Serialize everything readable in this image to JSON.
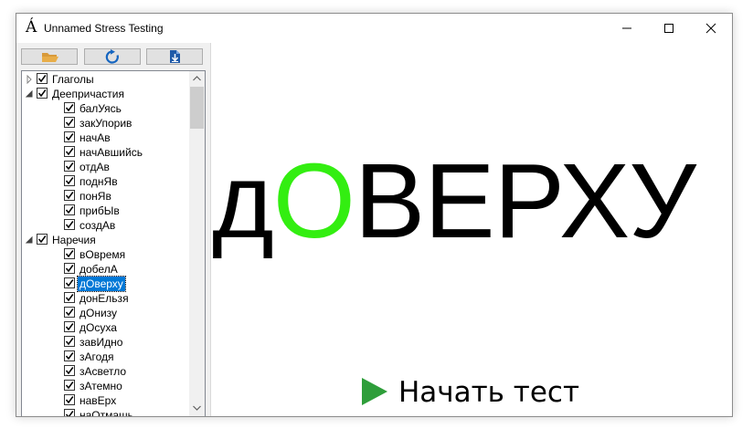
{
  "window": {
    "title": "Unnamed Stress Testing",
    "icon": "Á",
    "icon_name": "accent-a-icon"
  },
  "toolbar": {
    "open_icon": "folder-open-icon",
    "refresh_icon": "refresh-icon",
    "export_icon": "file-download-icon"
  },
  "tree": {
    "nodes": [
      {
        "label": "Глаголы",
        "level": 0,
        "expander": "collapsed",
        "checked": true
      },
      {
        "label": "Деепричастия",
        "level": 0,
        "expander": "expanded",
        "checked": true
      },
      {
        "label": "балУясь",
        "level": 1,
        "checked": true
      },
      {
        "label": "закУпорив",
        "level": 1,
        "checked": true
      },
      {
        "label": "начАв",
        "level": 1,
        "checked": true
      },
      {
        "label": "начАвшийсь",
        "level": 1,
        "checked": true
      },
      {
        "label": "отдАв",
        "level": 1,
        "checked": true
      },
      {
        "label": "поднЯв",
        "level": 1,
        "checked": true
      },
      {
        "label": "понЯв",
        "level": 1,
        "checked": true
      },
      {
        "label": "прибЫв",
        "level": 1,
        "checked": true
      },
      {
        "label": "создАв",
        "level": 1,
        "checked": true
      },
      {
        "label": "Наречия",
        "level": 0,
        "expander": "expanded",
        "checked": true
      },
      {
        "label": "вОвремя",
        "level": 1,
        "checked": true
      },
      {
        "label": "добелА",
        "level": 1,
        "checked": true
      },
      {
        "label": "дОверху",
        "level": 1,
        "checked": true,
        "selected": true
      },
      {
        "label": "донЕльзя",
        "level": 1,
        "checked": true
      },
      {
        "label": "дОнизу",
        "level": 1,
        "checked": true
      },
      {
        "label": "дОсуха",
        "level": 1,
        "checked": true
      },
      {
        "label": "завИдно",
        "level": 1,
        "checked": true
      },
      {
        "label": "зАгодя",
        "level": 1,
        "checked": true
      },
      {
        "label": "зАсветло",
        "level": 1,
        "checked": true
      },
      {
        "label": "зАтемно",
        "level": 1,
        "checked": true
      },
      {
        "label": "навЕрх",
        "level": 1,
        "checked": true
      },
      {
        "label": "наОтмашь",
        "level": 1,
        "checked": true
      }
    ]
  },
  "display": {
    "word_prefix": "д",
    "word_accent": "О",
    "word_suffix": "ВЕРХУ",
    "accent_color": "#33ee11"
  },
  "start_button": {
    "label": "Начать тест",
    "icon": "play-icon",
    "icon_color": "#2e9e3a"
  }
}
